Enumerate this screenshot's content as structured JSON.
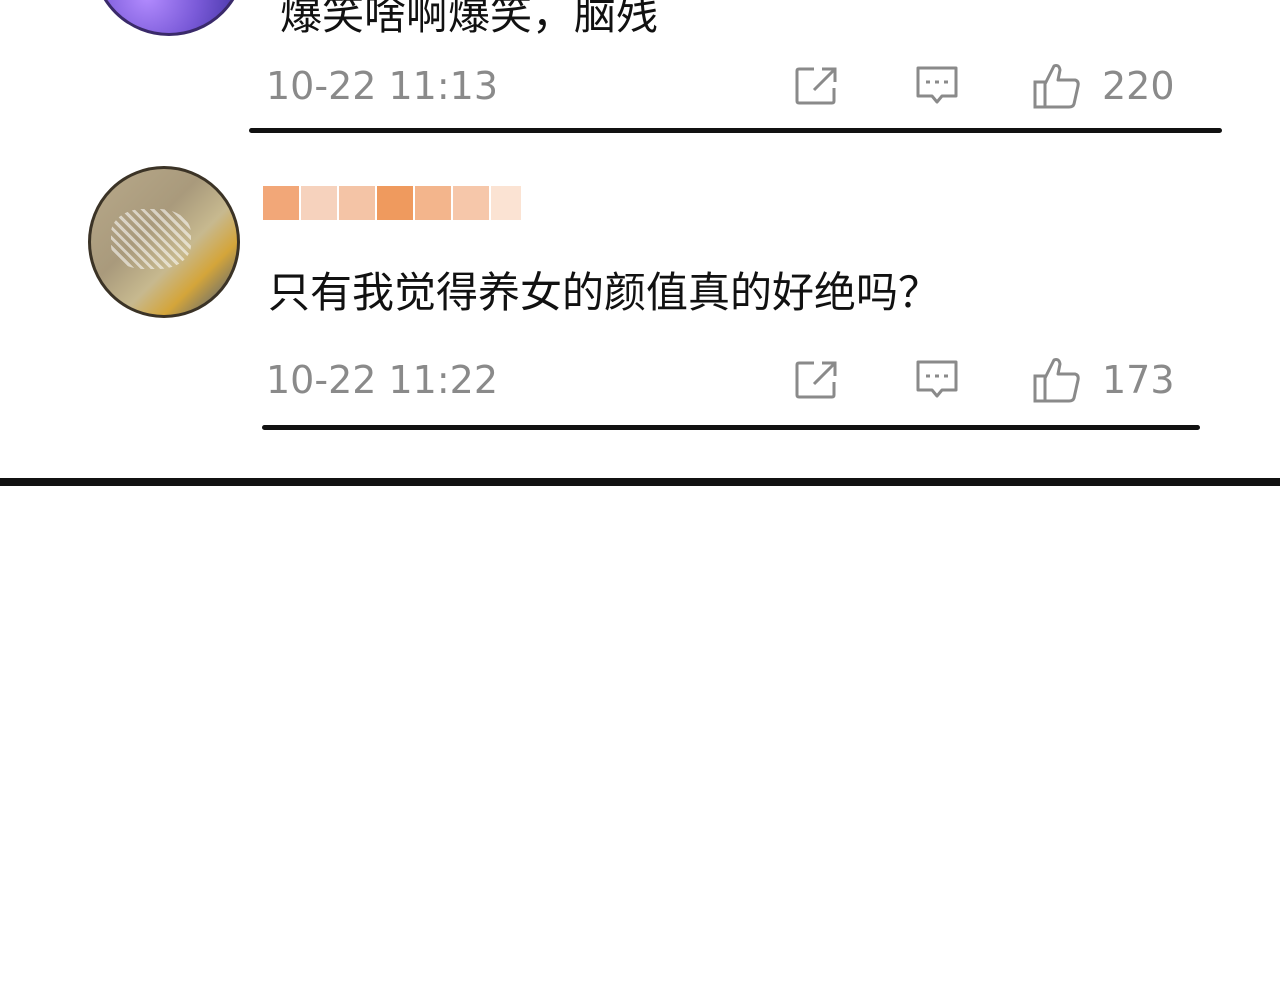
{
  "comments": [
    {
      "content": "爆笑啥啊爆笑，脑残",
      "time": "10-22 11:13",
      "likes": "220",
      "icons": [
        "share-icon",
        "reply-icon",
        "thumbs-up-icon"
      ]
    },
    {
      "content": "只有我觉得养女的颜值真的好绝吗？",
      "time": "10-22 11:22",
      "likes": "173",
      "icons": [
        "share-icon",
        "reply-icon",
        "thumbs-up-icon"
      ]
    }
  ],
  "colors": {
    "meta_gray": "#8a8a8a",
    "text": "#111111",
    "username_pixelated": "#f0a060"
  }
}
